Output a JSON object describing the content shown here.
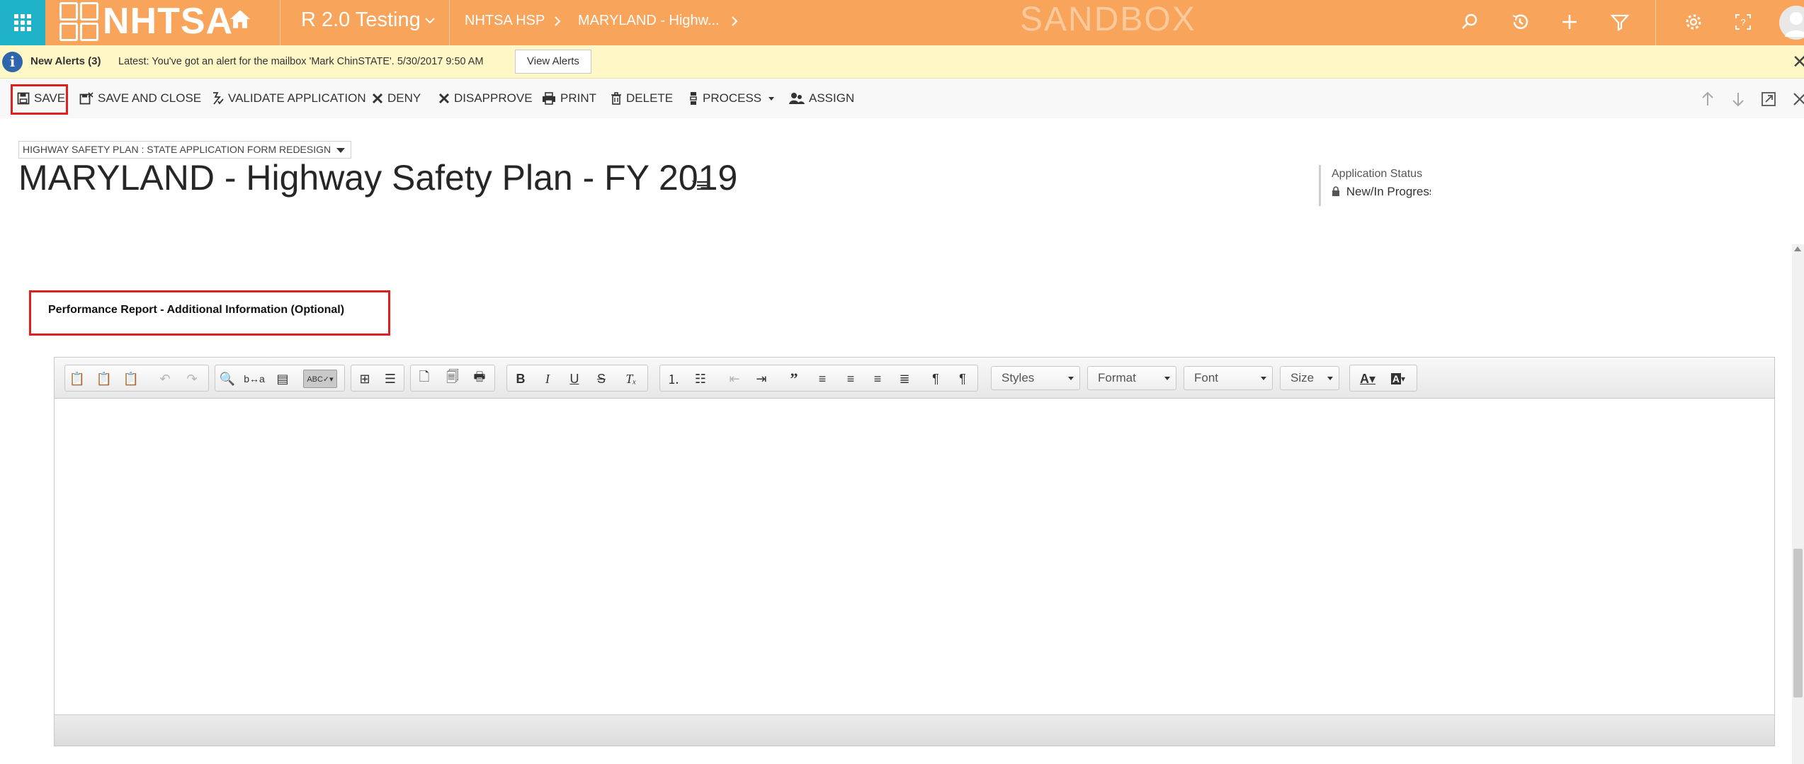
{
  "topnav": {
    "logo_text": "NHTSA",
    "app_title": "R 2.0 Testing",
    "breadcrumb": [
      "NHTSA HSP",
      "MARYLAND - Highw..."
    ],
    "environment_label": "SANDBOX",
    "icons": [
      "app-launcher-icon",
      "home-icon",
      "search-icon",
      "history-icon",
      "plus-icon",
      "filter-icon",
      "gear-icon",
      "help-icon",
      "user-avatar-icon"
    ],
    "colors": {
      "nav_bg": "#f9a45b",
      "launcher_bg": "#1fb2c8"
    }
  },
  "alert": {
    "title": "New Alerts (3)",
    "text": "Latest: You've got an alert for the mailbox 'Mark ChinSTATE'. 5/30/2017 9:50 AM",
    "button": "View Alerts",
    "bg_color": "#fff8c6"
  },
  "commands": {
    "save": "SAVE",
    "save_close": "SAVE AND CLOSE",
    "validate": "VALIDATE APPLICATION",
    "deny": "DENY",
    "disapprove": "DISAPPROVE",
    "print": "PRINT",
    "delete": "DELETE",
    "process": "PROCESS",
    "assign": "ASSIGN",
    "highlight_color": "#e02020"
  },
  "form": {
    "selector": "HIGHWAY SAFETY PLAN : STATE APPLICATION FORM REDESIGN",
    "title": "MARYLAND - Highway Safety Plan - FY 2019",
    "status_label": "Application Status",
    "status_value": "New/In Progress"
  },
  "section": {
    "title": "Performance Report - Additional Information (Optional)"
  },
  "editor": {
    "combos": {
      "styles": "Styles",
      "format": "Format",
      "font": "Font",
      "size": "Size"
    }
  }
}
